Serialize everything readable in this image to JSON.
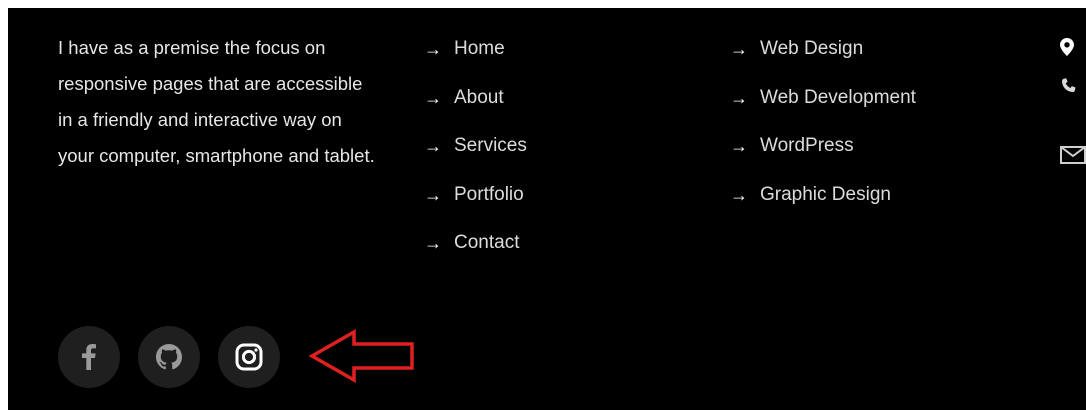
{
  "about": {
    "text": "I have as a premise the focus on responsive pages that are accessible in a friendly and interactive way on your computer, smartphone and tablet."
  },
  "nav_links": [
    {
      "label": "Home"
    },
    {
      "label": "About"
    },
    {
      "label": "Services"
    },
    {
      "label": "Portfolio"
    },
    {
      "label": "Contact"
    }
  ],
  "service_links": [
    {
      "label": "Web Design"
    },
    {
      "label": "Web Development"
    },
    {
      "label": "WordPress"
    },
    {
      "label": "Graphic Design"
    }
  ],
  "link_arrow": "→",
  "contact_icons": [
    "map-pin-icon",
    "phone-icon",
    "envelope-icon"
  ],
  "social_icons": [
    "facebook-icon",
    "github-icon",
    "instagram-icon"
  ],
  "annotation": {
    "shape": "arrow-left",
    "color": "#e02020"
  },
  "colors": {
    "background": "#000000",
    "text": "#e6e6e6",
    "social_bg": "#1f1f1f"
  }
}
